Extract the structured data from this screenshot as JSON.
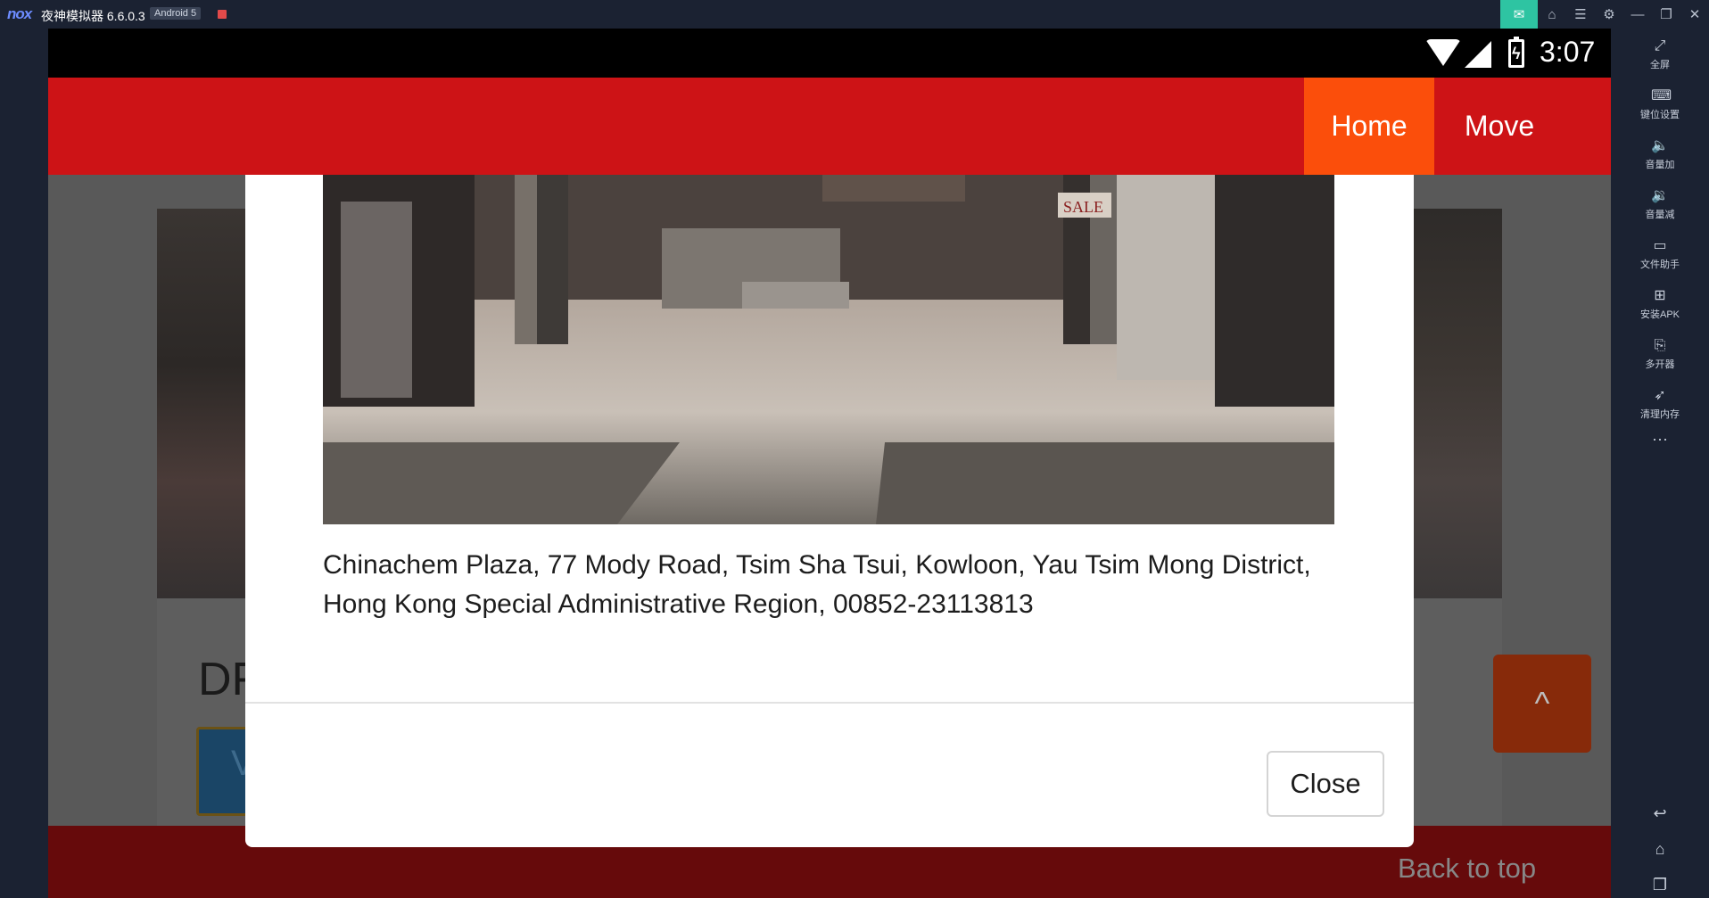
{
  "emulator": {
    "logo": "nox",
    "title": "夜神模拟器 6.6.0.3",
    "android_badge": "Android 5",
    "toolbar_icons": [
      "mail-icon",
      "shirt-icon",
      "menu-icon",
      "gear-icon",
      "minimize-icon",
      "restore-icon",
      "close-icon"
    ],
    "sidebar": [
      {
        "icon": "fullscreen-icon",
        "label": "全屏"
      },
      {
        "icon": "keyboard-icon",
        "label": "键位设置"
      },
      {
        "icon": "volume-up-icon",
        "label": "音量加"
      },
      {
        "icon": "volume-down-icon",
        "label": "音量减"
      },
      {
        "icon": "file-helper-icon",
        "label": "文件助手"
      },
      {
        "icon": "install-apk-icon",
        "label": "安装APK"
      },
      {
        "icon": "multi-instance-icon",
        "label": "多开器"
      },
      {
        "icon": "rocket-icon",
        "label": "清理内存"
      }
    ],
    "sidebar_more": "···",
    "sidebar_nav": [
      "back-icon",
      "home-icon",
      "recent-apps-icon"
    ]
  },
  "status_bar": {
    "time": "3:07"
  },
  "appbar": {
    "nav": [
      {
        "label": "Home",
        "active": true,
        "color": "#fb4e0b"
      },
      {
        "label": "Move",
        "active": false
      }
    ],
    "background": "#cd1316"
  },
  "background_page": {
    "title_fragment": "DF",
    "button_fragment": "V",
    "scroll_top_label": "^",
    "footer_link": "Back to top"
  },
  "modal": {
    "photo_sign": "SALE",
    "address": "Chinachem Plaza, 77 Mody Road, Tsim Sha Tsui, Kowloon, Yau Tsim Mong District, Hong Kong Special Administrative Region, 00852-23113813",
    "close_label": "Close"
  }
}
